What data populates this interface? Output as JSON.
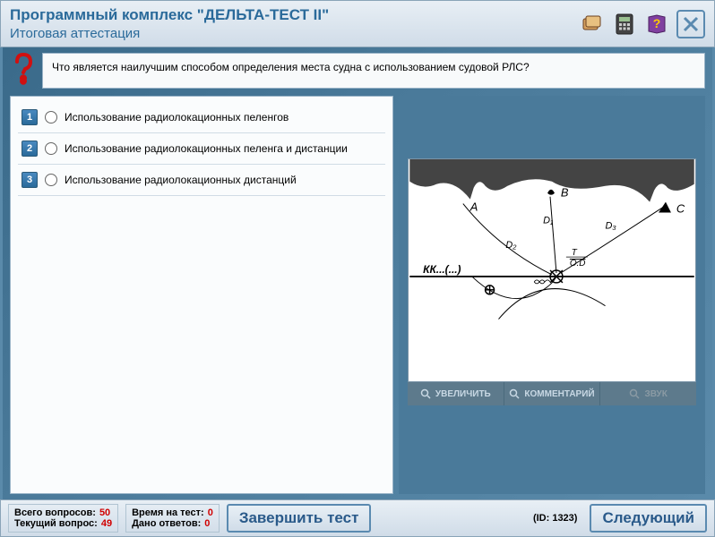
{
  "header": {
    "title": "Программный комплекс \"ДЕЛЬТА-ТЕСТ II\"",
    "subtitle": "Итоговая аттестация"
  },
  "question": {
    "text": "Что является наилучшим способом определения места судна с использованием судовой РЛС?"
  },
  "answers": [
    {
      "num": "1",
      "label": "Использование радиолокационных пеленгов"
    },
    {
      "num": "2",
      "label": "Использование радиолокационных пеленга и дистанции"
    },
    {
      "num": "3",
      "label": "Использование радиолокационных дистанций"
    }
  ],
  "diagram": {
    "labels": {
      "A": "A",
      "B": "B",
      "C": "C",
      "D1": "D₁",
      "D2": "D₂",
      "D3": "D₃",
      "T": "T",
      "OD": "O.D",
      "KK": "КК...(...)"
    }
  },
  "media_buttons": {
    "zoom": "УВЕЛИЧИТЬ",
    "comment": "КОММЕНТАРИЙ",
    "sound": "ЗВУК"
  },
  "footer": {
    "total_label": "Всего вопросов:",
    "total_val": "50",
    "current_label": "Текущий вопрос:",
    "current_val": "49",
    "time_label": "Время на тест:",
    "time_val": "0",
    "answered_label": "Дано ответов:",
    "answered_val": "0",
    "finish": "Завершить тест",
    "id": "(ID: 1323)",
    "next": "Следующий"
  }
}
